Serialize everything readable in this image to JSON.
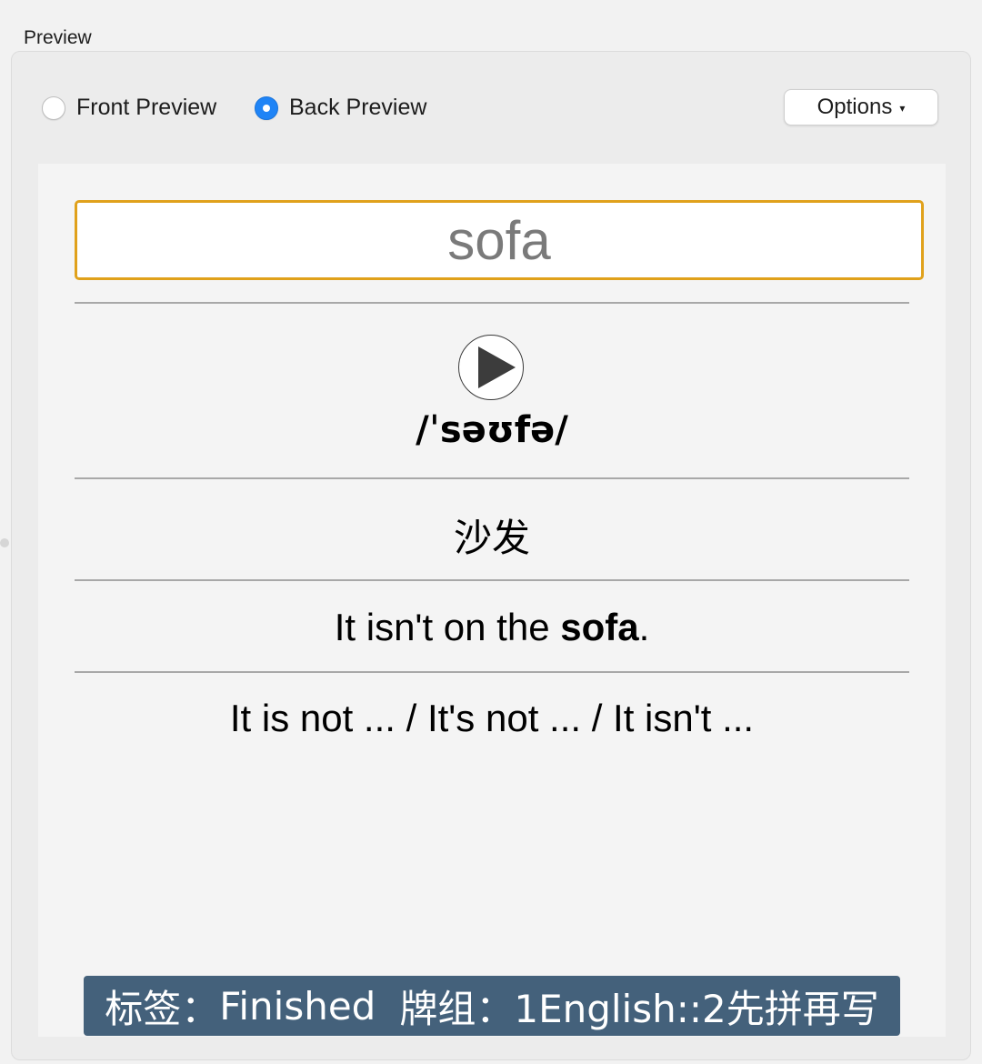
{
  "section_label": "Preview",
  "radios": {
    "front_label": "Front Preview",
    "back_label": "Back Preview",
    "selected": "back"
  },
  "options_button": {
    "label": "Options",
    "caret": "▾"
  },
  "card": {
    "word": "sofa",
    "audio_icon": "play-icon",
    "phonetic": "/ˈsəʊfə/",
    "meaning": "沙发",
    "example": {
      "before": "It isn't on the ",
      "bold": "sofa",
      "after": "."
    },
    "pattern": "It is not ... / It's not ... / It isn't ...",
    "tags": {
      "tag_label": "标签：",
      "tag_value": "Finished",
      "deck_label": "牌组：",
      "deck_value": "1English::2先拼再写"
    }
  },
  "colors": {
    "radio_selected": "#1f84f6",
    "word_box_border": "#e0a11b",
    "tag_bar_bg": "#44617b"
  }
}
